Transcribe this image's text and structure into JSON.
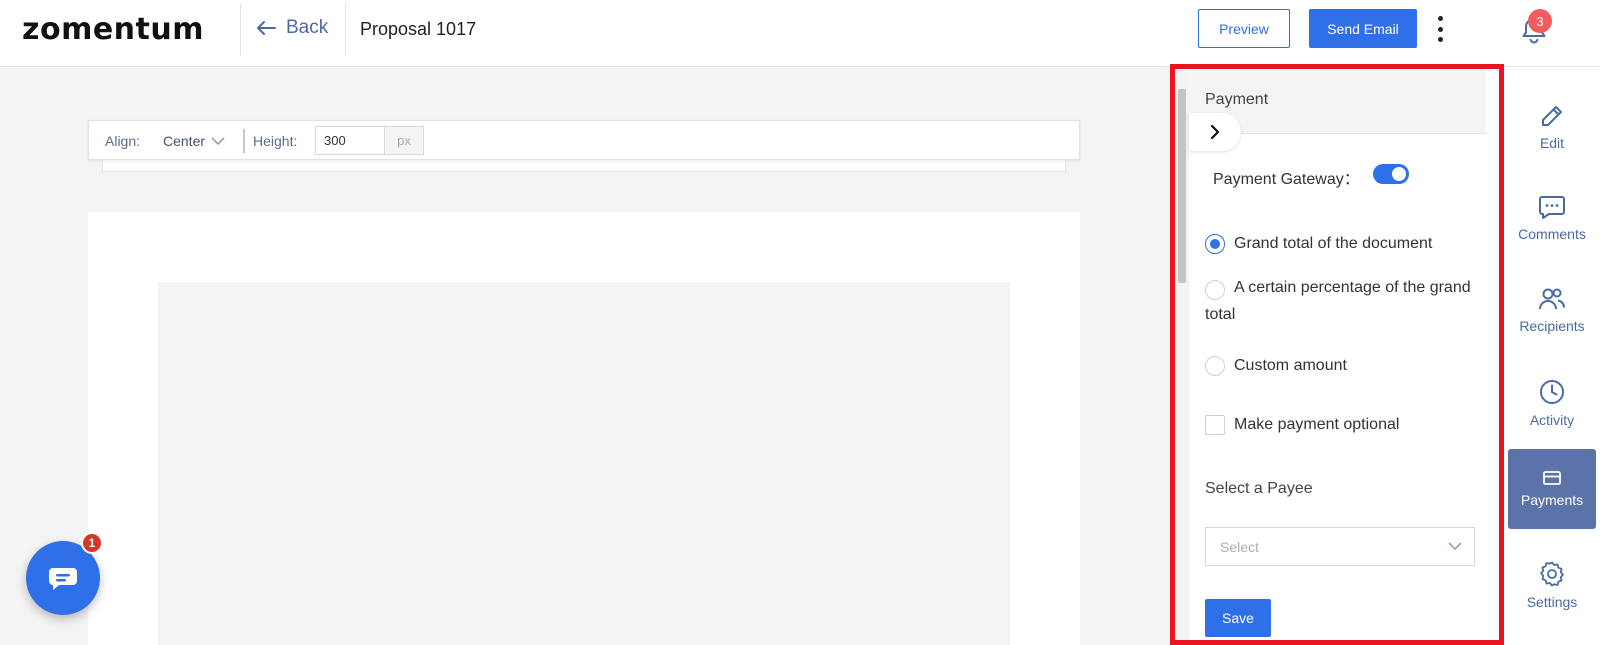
{
  "app": {
    "logo": "zomentum"
  },
  "header": {
    "back_label": "Back",
    "doc_title": "Proposal 1017",
    "preview_label": "Preview",
    "send_label": "Send Email",
    "notifications_count": "3"
  },
  "toolbar": {
    "align_label": "Align:",
    "align_value": "Center",
    "height_label": "Height:",
    "height_value": "300",
    "height_unit": "px"
  },
  "chat": {
    "badge_count": "1"
  },
  "payment_panel": {
    "title": "Payment",
    "gateway_label": "Payment Gateway：",
    "gateway_enabled": true,
    "options": [
      {
        "label": "Grand total of the document",
        "checked": true
      },
      {
        "label": "A certain percentage of the grand total",
        "checked": false
      },
      {
        "label": "Custom amount",
        "checked": false
      }
    ],
    "optional_label": "Make payment optional",
    "optional_checked": false,
    "payee_label": "Select a Payee",
    "payee_placeholder": "Select",
    "save_label": "Save"
  },
  "rail": {
    "items": [
      {
        "label": "Edit",
        "icon": "pencil-icon",
        "active": false
      },
      {
        "label": "Comments",
        "icon": "comment-icon",
        "active": false
      },
      {
        "label": "Recipients",
        "icon": "users-icon",
        "active": false
      },
      {
        "label": "Activity",
        "icon": "clock-icon",
        "active": false
      },
      {
        "label": "Payments",
        "icon": "credit-card-icon",
        "active": true
      },
      {
        "label": "Settings",
        "icon": "gear-icon",
        "active": false
      }
    ]
  },
  "colors": {
    "primary": "#2f6fe8",
    "rail_active": "#5b73a8",
    "highlight_outline": "#e8141f",
    "badge_red": "#f25c5c"
  }
}
